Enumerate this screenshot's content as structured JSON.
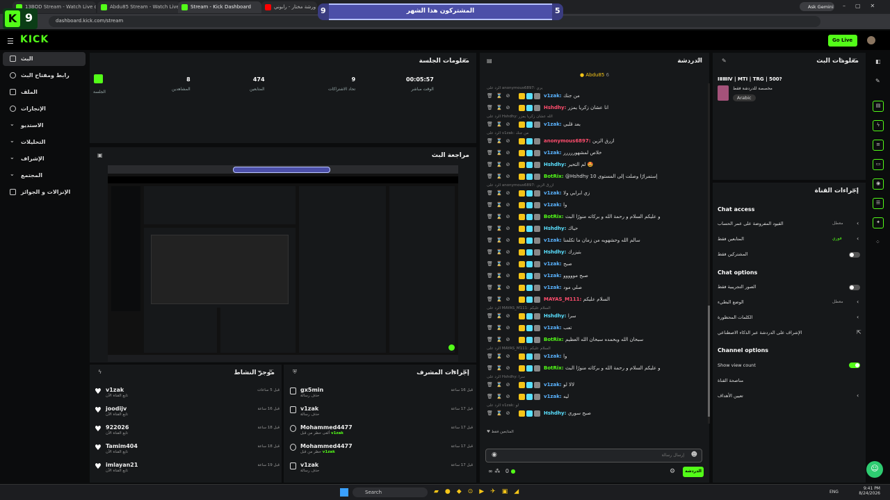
{
  "browser": {
    "tabs": [
      "13BOD Stream - Watch Live on",
      "Abdu85 Stream - Watch Live on",
      "Stream - Kick Dashboard",
      "",
      "ورشة مختار - رابوني"
    ],
    "url": "dashboard.kick.com/stream",
    "gemini": "Ask Gemini"
  },
  "overlay": {
    "title": "المشتركون هذا الشهر",
    "left_num": "9",
    "right_num": "5",
    "corner_num": "9"
  },
  "header": {
    "logo": "KICK",
    "go_live": "Go Live"
  },
  "sidebar": {
    "items": [
      "البث",
      "رابط ومفتاح البث",
      "الملف",
      "الإنجازات",
      "الاستديو",
      "التحليلات",
      "الإشراف",
      "المجتمع",
      "الإنزالات و الجوائز"
    ]
  },
  "session": {
    "title": "معلومات الجلسة",
    "badge_label": "الجلسة",
    "stats": [
      {
        "value": "8",
        "label": "المشاهدين"
      },
      {
        "value": "474",
        "label": "المتابعين"
      },
      {
        "value": "9",
        "label": "تحاد الاشتراكات"
      },
      {
        "value": "00:05:57",
        "label": "الوقت مباشر"
      }
    ]
  },
  "preview": {
    "title": "مراجعة البث"
  },
  "activity": {
    "title": "موجز النشاط",
    "items": [
      {
        "name": "v1zak",
        "sub": "تابع القناة الآن",
        "time": "قبل 5 ساعات"
      },
      {
        "name": "joodijv",
        "sub": "تابع القناة الآن",
        "time": "قبل 16 ساعة"
      },
      {
        "name": "922026",
        "sub": "تابع القناة الآن",
        "time": "قبل 18 ساعة"
      },
      {
        "name": "Tamim404",
        "sub": "تابع القناة الآن",
        "time": "قبل 18 ساعة"
      },
      {
        "name": "imlayan21",
        "sub": "تابع القناة الآن",
        "time": "قبل 19 ساعة"
      }
    ]
  },
  "mod": {
    "title": "إجراءات المشرف",
    "items": [
      {
        "name": "gx5min",
        "sub": "حذف رسالة",
        "time": "قبل 16 ساعة"
      },
      {
        "name": "v1zak",
        "sub": "حذف رسالة",
        "time": "قبل 17 ساعة"
      },
      {
        "name": "Mohammed4477",
        "sub": "ألغى حظر من قبل",
        "by": "v1zak",
        "time": "قبل 17 ساعة"
      },
      {
        "name": "Mohammed4477",
        "sub": "حظر من قبل",
        "by": "v1zak",
        "time": "قبل 17 ساعة"
      },
      {
        "name": "v1zak",
        "sub": "حذف رسالة",
        "time": "قبل 17 ساعة"
      }
    ]
  },
  "chat": {
    "title": "الدردشة",
    "pinned": "Abdu85",
    "pinned_count": "6",
    "rows": [
      {
        "reply": "الرد على anonymous6897: يري",
        "user": "v1zak",
        "color": "#5ab3ff",
        "msg": "من جنك"
      },
      {
        "user": "Hshdhy",
        "color": "#ff4d6d",
        "msg": "انا عشان زكريا يمزر"
      },
      {
        "reply": "الرد على Hshdhy: الله عشان زكريا يمزر",
        "user": "v1zak",
        "color": "#5ab3ff",
        "msg": "بعد قلبي"
      },
      {
        "reply": "الرد على v1zak: من جنك",
        "user": "anonymous6897",
        "color": "#ff4d6d",
        "msg": "ازرق الزين"
      },
      {
        "user": "v1zak",
        "color": "#5ab3ff",
        "msg": "خلاص لمشهوررررر"
      },
      {
        "user": "Hshdhy",
        "color": "#5ae0ff",
        "msg": "لم التحير 🤩"
      },
      {
        "user": "BotRix",
        "color": "#53fc18",
        "msg": "@Hshdhy إستمرارًا وصلت إلى المستوى 10"
      },
      {
        "reply": "الرد على anonymous6897: ازرق الزين",
        "user": "v1zak",
        "color": "#5ab3ff",
        "msg": "زي ابرابي ولا"
      },
      {
        "user": "v1zak",
        "color": "#5ab3ff",
        "msg": "وا"
      },
      {
        "user": "BotRix",
        "color": "#53fc18",
        "msg": "و عليكم السلام و رحمة الله و بركاته منورًا البث"
      },
      {
        "user": "Hshdhy",
        "color": "#5ae0ff",
        "msg": "حياك"
      },
      {
        "user": "v1zak",
        "color": "#5ab3ff",
        "msg": "سالم الله وحشهويه من زمان ما تكلمنا"
      },
      {
        "user": "Hshdhy",
        "color": "#5ae0ff",
        "msg": "بتيزرك"
      },
      {
        "user": "v1zak",
        "color": "#5ab3ff",
        "msg": "صبح"
      },
      {
        "user": "v1zak",
        "color": "#5ab3ff",
        "msg": "صبح مووووو"
      },
      {
        "user": "v1zak",
        "color": "#5ab3ff",
        "msg": "صلي مود"
      },
      {
        "user": "MAYAS_M111",
        "color": "#ff4d6d",
        "msg": "السلام عليكم"
      },
      {
        "reply": "الرد على MAYAS_M111: السلام عليكم",
        "user": "Hshdhy",
        "color": "#5ae0ff",
        "msg": "سرا"
      },
      {
        "user": "v1zak",
        "color": "#5ab3ff",
        "msg": "تعب"
      },
      {
        "user": "BotRix",
        "color": "#53fc18",
        "msg": "سبحان الله وبحمده سبحان الله العظيم"
      },
      {
        "reply": "الرد على MAYAS_M111: السلام عليكم",
        "user": "v1zak",
        "color": "#5ab3ff",
        "msg": "وا"
      },
      {
        "user": "BotRix",
        "color": "#53fc18",
        "msg": "و عليكم السلام و رحمة الله و بركاته منورًا البث"
      },
      {
        "reply": "الرد على Hshdhy: سرا",
        "user": "v1zak",
        "color": "#5ab3ff",
        "msg": "لالا لو"
      },
      {
        "user": "v1zak",
        "color": "#5ab3ff",
        "msg": "ليه"
      },
      {
        "reply": "الرد على v1zak: لو",
        "user": "Hshdhy",
        "color": "#5ae0ff",
        "msg": "صبح سوري"
      }
    ],
    "followers_only": "المتابعين فقط",
    "input_placeholder": "إرسال رسالة",
    "send_label": "الدردشة",
    "points": "0"
  },
  "stream_info": {
    "title": "معلومات البث",
    "name": "ⅠⅡⅢⅣ | MTI | TRG | 500?",
    "category": "مخصصة للدردشة فقط",
    "language": "Arabic"
  },
  "channel": {
    "title": "إجراءات القناة",
    "chat_access": "Chat access",
    "rows1": [
      {
        "label": "القيود المفروضة على عمر الحساب",
        "value": "معطل"
      },
      {
        "label": "المتابعين فقط",
        "value": "فوري"
      },
      {
        "label": "المشتركين فقط",
        "value": ""
      }
    ],
    "chat_options": "Chat options",
    "rows2": [
      {
        "label": "الصور التجريبية فقط",
        "value": ""
      },
      {
        "label": "الوضع البطيء",
        "value": "معطل"
      },
      {
        "label": "الكلمات المحظورة",
        "value": ""
      },
      {
        "label": "الإشراف على الدردشة عبر الذكاء الاصطناعي",
        "value": ""
      }
    ],
    "channel_options": "Channel options",
    "show_view_count": "Show view count",
    "rows3": [
      "مناصحة القناة",
      "تعيين الأهداف"
    ]
  },
  "taskbar": {
    "search": "Search",
    "lang": "ENG",
    "time": "9:41 PM",
    "date": "8/24/2026"
  }
}
